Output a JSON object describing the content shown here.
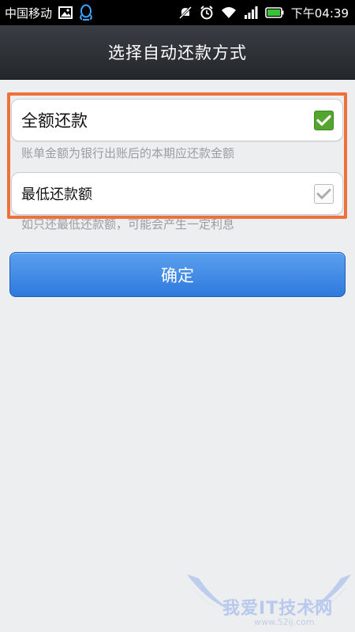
{
  "status_bar": {
    "carrier": "中国移动",
    "time": "下午04:39",
    "icons": [
      "image-icon",
      "qq-icon",
      "mute-icon",
      "alarm-icon",
      "wifi-icon",
      "signal-icon",
      "battery-icon"
    ]
  },
  "header": {
    "title": "选择自动还款方式"
  },
  "options": [
    {
      "label": "全额还款",
      "checked": true,
      "description": "账单金额为银行出账后的本期应还款金额"
    },
    {
      "label": "最低还款额",
      "checked": false,
      "description": "如只还最低还款额，可能会产生一定利息"
    }
  ],
  "confirm_label": "确定",
  "watermark": {
    "text": "我爱IT技术网",
    "url": "www.52ij.com"
  },
  "colors": {
    "highlight": "#f0703a",
    "checked": "#54a430",
    "button": "#3a86e6",
    "status_bar": "#000000",
    "title_bar": "#2e3136"
  }
}
